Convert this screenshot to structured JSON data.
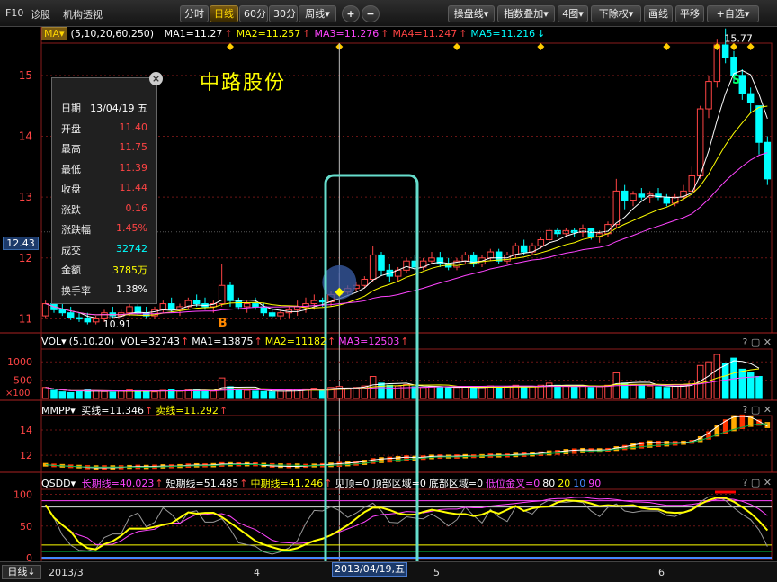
{
  "toolbar": {
    "left_tabs": [
      "F10",
      "诊股",
      "机构透视"
    ],
    "period_buttons": [
      "分时",
      "日线",
      "60分",
      "30分",
      "周线▾"
    ],
    "active_period": "日线",
    "zoom_in": "+",
    "zoom_out": "−",
    "right_buttons": [
      "操盘线▾",
      "指数叠加▾",
      "4图▾",
      "下除权▾",
      "画线",
      "平移",
      "+自选▾"
    ]
  },
  "stock_name": "中路股份",
  "ma_legend": {
    "selector": "MA▾",
    "params": "(5,10,20,60,250)",
    "items": [
      {
        "label": "MA1=11.27",
        "arrow": "↑",
        "color": "#ffffff"
      },
      {
        "label": "MA2=11.257",
        "arrow": "↑",
        "color": "#ffff00"
      },
      {
        "label": "MA3=11.276",
        "arrow": "↑",
        "color": "#ff44ff"
      },
      {
        "label": "MA4=11.247",
        "arrow": "↑",
        "color": "#ff4444"
      },
      {
        "label": "MA5=11.216",
        "arrow": "↓",
        "color": "#00ffff"
      }
    ]
  },
  "price_axis": {
    "ticks": [
      "15",
      "14",
      "13",
      "12",
      "11"
    ],
    "current_price_label": "12.43",
    "min": 10.8,
    "max": 15.5
  },
  "annotations": {
    "high_label": "15.77",
    "low_label": "10.91",
    "buy_marker": "B",
    "sell_marker": "S"
  },
  "info_panel": {
    "close_icon": "×",
    "rows": [
      {
        "k": "日期",
        "v": "13/04/19 五",
        "color": "#ffffff"
      },
      {
        "k": "开盘",
        "v": "11.40",
        "color": "#ff4444"
      },
      {
        "k": "最高",
        "v": "11.75",
        "color": "#ff4444"
      },
      {
        "k": "最低",
        "v": "11.39",
        "color": "#ff4444"
      },
      {
        "k": "收盘",
        "v": "11.44",
        "color": "#ff4444"
      },
      {
        "k": "涨跌",
        "v": "0.16",
        "color": "#ff4444"
      },
      {
        "k": "涨跌幅",
        "v": "+1.45%",
        "color": "#ff4444"
      },
      {
        "k": "成交",
        "v": "32742",
        "color": "#00ffff"
      },
      {
        "k": "金额",
        "v": "3785万",
        "color": "#ffff00"
      },
      {
        "k": "换手率",
        "v": "1.38%",
        "color": "#ffffff"
      }
    ]
  },
  "vol_panel": {
    "name": "VOL▾",
    "params": "(5,10,20)",
    "items": [
      {
        "label": "VOL=32743",
        "arrow": "↑",
        "color": "#ffffff"
      },
      {
        "label": "MA1=13875",
        "arrow": "↑",
        "color": "#ffffff"
      },
      {
        "label": "MA2=11182",
        "arrow": "↑",
        "color": "#ffff00"
      },
      {
        "label": "MA3=12503",
        "arrow": "↑",
        "color": "#ff44ff"
      }
    ],
    "ticks": [
      "1000",
      "500"
    ],
    "unit_label": "×100"
  },
  "mmpp_panel": {
    "name": "MMPP▾",
    "items": [
      {
        "label": "买线=11.346",
        "arrow": "↑",
        "color": "#ffffff"
      },
      {
        "label": "卖线=11.292",
        "arrow": "↑",
        "color": "#ffff00"
      }
    ],
    "ticks": [
      "14",
      "12"
    ]
  },
  "qsdd_panel": {
    "name": "QSDD▾",
    "items": [
      {
        "label": "长期线=40.023",
        "arrow": "↑",
        "color": "#ff44ff"
      },
      {
        "label": "短期线=51.485",
        "arrow": "↑",
        "color": "#ffffff"
      },
      {
        "label": "中期线=41.246",
        "arrow": "↑",
        "color": "#ffff00"
      },
      {
        "label": "见顶=0",
        "arrow": "",
        "color": "#ffffff"
      },
      {
        "label": "顶部区域=0",
        "arrow": "",
        "color": "#ffffff"
      },
      {
        "label": "底部区域=0",
        "arrow": "",
        "color": "#ffffff"
      },
      {
        "label": "低位金叉=0",
        "arrow": "",
        "color": "#ff44ff"
      },
      {
        "label": "80",
        "arrow": "",
        "color": "#ffffff"
      },
      {
        "label": "20",
        "arrow": "",
        "color": "#ffff00"
      },
      {
        "label": "10",
        "arrow": "",
        "color": "#4488ff"
      },
      {
        "label": "90",
        "arrow": "",
        "color": "#ff44ff"
      }
    ],
    "ticks": [
      "100",
      "50",
      "0"
    ]
  },
  "sub_controls": "? ▢ ✕",
  "bottom": {
    "period": "日线↓",
    "labels": [
      "2013/3",
      "4",
      "5",
      "6"
    ],
    "selected_date": "2013/04/19,五"
  },
  "colors": {
    "up": "#ff4444",
    "down": "#00ffff",
    "highlight_box": "#66ddcc"
  },
  "chart_data": {
    "type": "candlestick",
    "candles": [
      {
        "o": 11.05,
        "h": 11.3,
        "l": 11.0,
        "c": 11.25
      },
      {
        "o": 11.25,
        "h": 11.35,
        "l": 11.1,
        "c": 11.15
      },
      {
        "o": 11.15,
        "h": 11.25,
        "l": 11.05,
        "c": 11.1
      },
      {
        "o": 11.1,
        "h": 11.2,
        "l": 10.98,
        "c": 11.02
      },
      {
        "o": 11.02,
        "h": 11.1,
        "l": 10.95,
        "c": 11.0
      },
      {
        "o": 11.0,
        "h": 11.1,
        "l": 10.91,
        "c": 10.95
      },
      {
        "o": 10.95,
        "h": 11.05,
        "l": 10.91,
        "c": 11.0
      },
      {
        "o": 11.0,
        "h": 11.15,
        "l": 10.95,
        "c": 11.1
      },
      {
        "o": 11.1,
        "h": 11.2,
        "l": 11.0,
        "c": 11.05
      },
      {
        "o": 11.05,
        "h": 11.15,
        "l": 11.0,
        "c": 11.1
      },
      {
        "o": 11.1,
        "h": 11.25,
        "l": 11.05,
        "c": 11.2
      },
      {
        "o": 11.2,
        "h": 11.25,
        "l": 11.05,
        "c": 11.1
      },
      {
        "o": 11.1,
        "h": 11.2,
        "l": 11.0,
        "c": 11.05
      },
      {
        "o": 11.05,
        "h": 11.2,
        "l": 11.0,
        "c": 11.15
      },
      {
        "o": 11.15,
        "h": 11.3,
        "l": 11.1,
        "c": 11.25
      },
      {
        "o": 11.25,
        "h": 11.35,
        "l": 11.1,
        "c": 11.15
      },
      {
        "o": 11.15,
        "h": 11.25,
        "l": 11.05,
        "c": 11.2
      },
      {
        "o": 11.2,
        "h": 11.35,
        "l": 11.15,
        "c": 11.3
      },
      {
        "o": 11.3,
        "h": 11.4,
        "l": 11.2,
        "c": 11.25
      },
      {
        "o": 11.25,
        "h": 11.35,
        "l": 11.15,
        "c": 11.2
      },
      {
        "o": 11.2,
        "h": 11.3,
        "l": 11.1,
        "c": 11.25
      },
      {
        "o": 11.25,
        "h": 11.9,
        "l": 11.2,
        "c": 11.55
      },
      {
        "o": 11.55,
        "h": 11.6,
        "l": 11.2,
        "c": 11.3
      },
      {
        "o": 11.3,
        "h": 11.35,
        "l": 11.15,
        "c": 11.2
      },
      {
        "o": 11.2,
        "h": 11.3,
        "l": 11.1,
        "c": 11.25
      },
      {
        "o": 11.25,
        "h": 11.35,
        "l": 11.15,
        "c": 11.2
      },
      {
        "o": 11.2,
        "h": 11.25,
        "l": 11.05,
        "c": 11.1
      },
      {
        "o": 11.1,
        "h": 11.2,
        "l": 11.0,
        "c": 11.05
      },
      {
        "o": 11.05,
        "h": 11.15,
        "l": 10.98,
        "c": 11.1
      },
      {
        "o": 11.1,
        "h": 11.2,
        "l": 11.0,
        "c": 11.15
      },
      {
        "o": 11.15,
        "h": 11.3,
        "l": 11.05,
        "c": 11.2
      },
      {
        "o": 11.2,
        "h": 11.35,
        "l": 11.1,
        "c": 11.25
      },
      {
        "o": 11.25,
        "h": 11.4,
        "l": 11.15,
        "c": 11.3
      },
      {
        "o": 11.3,
        "h": 11.35,
        "l": 11.2,
        "c": 11.28
      },
      {
        "o": 11.28,
        "h": 11.45,
        "l": 11.2,
        "c": 11.4
      },
      {
        "o": 11.4,
        "h": 11.75,
        "l": 11.39,
        "c": 11.44
      },
      {
        "o": 11.44,
        "h": 11.55,
        "l": 11.4,
        "c": 11.5
      },
      {
        "o": 11.5,
        "h": 11.6,
        "l": 11.45,
        "c": 11.55
      },
      {
        "o": 11.55,
        "h": 11.7,
        "l": 11.5,
        "c": 11.65
      },
      {
        "o": 11.65,
        "h": 12.2,
        "l": 11.6,
        "c": 12.05
      },
      {
        "o": 12.05,
        "h": 12.1,
        "l": 11.7,
        "c": 11.8
      },
      {
        "o": 11.8,
        "h": 11.9,
        "l": 11.6,
        "c": 11.7
      },
      {
        "o": 11.7,
        "h": 11.85,
        "l": 11.6,
        "c": 11.8
      },
      {
        "o": 11.8,
        "h": 12.0,
        "l": 11.75,
        "c": 11.95
      },
      {
        "o": 11.95,
        "h": 12.05,
        "l": 11.8,
        "c": 11.85
      },
      {
        "o": 11.85,
        "h": 12.0,
        "l": 11.8,
        "c": 11.95
      },
      {
        "o": 11.95,
        "h": 12.1,
        "l": 11.9,
        "c": 12.0
      },
      {
        "o": 12.0,
        "h": 12.1,
        "l": 11.85,
        "c": 11.9
      },
      {
        "o": 11.9,
        "h": 12.0,
        "l": 11.8,
        "c": 11.85
      },
      {
        "o": 11.85,
        "h": 12.0,
        "l": 11.8,
        "c": 11.95
      },
      {
        "o": 11.95,
        "h": 12.1,
        "l": 11.9,
        "c": 12.05
      },
      {
        "o": 12.05,
        "h": 12.1,
        "l": 11.85,
        "c": 11.9
      },
      {
        "o": 11.9,
        "h": 12.05,
        "l": 11.85,
        "c": 12.0
      },
      {
        "o": 12.0,
        "h": 12.15,
        "l": 11.95,
        "c": 12.1
      },
      {
        "o": 12.1,
        "h": 12.15,
        "l": 11.9,
        "c": 11.95
      },
      {
        "o": 11.95,
        "h": 12.1,
        "l": 11.9,
        "c": 12.05
      },
      {
        "o": 12.05,
        "h": 12.25,
        "l": 12.0,
        "c": 12.2
      },
      {
        "o": 12.2,
        "h": 12.3,
        "l": 12.05,
        "c": 12.1
      },
      {
        "o": 12.1,
        "h": 12.25,
        "l": 12.05,
        "c": 12.2
      },
      {
        "o": 12.2,
        "h": 12.35,
        "l": 12.15,
        "c": 12.3
      },
      {
        "o": 12.3,
        "h": 12.5,
        "l": 12.25,
        "c": 12.45
      },
      {
        "o": 12.45,
        "h": 12.5,
        "l": 12.35,
        "c": 12.4
      },
      {
        "o": 12.4,
        "h": 12.5,
        "l": 12.35,
        "c": 12.45
      },
      {
        "o": 12.45,
        "h": 12.5,
        "l": 12.35,
        "c": 12.42
      },
      {
        "o": 12.42,
        "h": 12.55,
        "l": 12.35,
        "c": 12.48
      },
      {
        "o": 12.48,
        "h": 12.5,
        "l": 12.3,
        "c": 12.35
      },
      {
        "o": 12.35,
        "h": 12.45,
        "l": 12.25,
        "c": 12.4
      },
      {
        "o": 12.4,
        "h": 12.6,
        "l": 12.35,
        "c": 12.55
      },
      {
        "o": 12.55,
        "h": 13.3,
        "l": 12.5,
        "c": 13.1
      },
      {
        "o": 13.1,
        "h": 13.2,
        "l": 12.8,
        "c": 12.95
      },
      {
        "o": 12.95,
        "h": 13.1,
        "l": 12.85,
        "c": 13.05
      },
      {
        "o": 13.05,
        "h": 13.15,
        "l": 12.95,
        "c": 13.0
      },
      {
        "o": 13.0,
        "h": 13.1,
        "l": 12.9,
        "c": 13.05
      },
      {
        "o": 13.05,
        "h": 13.15,
        "l": 12.95,
        "c": 13.0
      },
      {
        "o": 13.0,
        "h": 13.05,
        "l": 12.85,
        "c": 12.9
      },
      {
        "o": 12.9,
        "h": 13.05,
        "l": 12.85,
        "c": 13.0
      },
      {
        "o": 13.0,
        "h": 13.2,
        "l": 12.95,
        "c": 13.1
      },
      {
        "o": 13.1,
        "h": 13.5,
        "l": 13.05,
        "c": 13.35
      },
      {
        "o": 13.35,
        "h": 14.5,
        "l": 13.3,
        "c": 14.45
      },
      {
        "o": 14.45,
        "h": 15.0,
        "l": 14.3,
        "c": 14.9
      },
      {
        "o": 14.9,
        "h": 15.6,
        "l": 14.8,
        "c": 15.5
      },
      {
        "o": 15.5,
        "h": 15.77,
        "l": 15.2,
        "c": 15.3
      },
      {
        "o": 15.3,
        "h": 15.4,
        "l": 14.9,
        "c": 15.0
      },
      {
        "o": 15.0,
        "h": 15.1,
        "l": 14.6,
        "c": 14.7
      },
      {
        "o": 14.7,
        "h": 14.8,
        "l": 14.4,
        "c": 14.55
      },
      {
        "o": 14.5,
        "h": 14.5,
        "l": 13.7,
        "c": 13.9
      },
      {
        "o": 13.9,
        "h": 14.0,
        "l": 13.2,
        "c": 13.3
      }
    ],
    "volume": [
      300,
      220,
      180,
      160,
      200,
      240,
      210,
      190,
      170,
      200,
      230,
      210,
      190,
      180,
      220,
      240,
      200,
      230,
      250,
      210,
      200,
      560,
      320,
      240,
      220,
      200,
      190,
      180,
      200,
      220,
      240,
      260,
      280,
      240,
      300,
      327,
      280,
      300,
      340,
      600,
      420,
      360,
      340,
      380,
      320,
      300,
      330,
      310,
      290,
      300,
      320,
      280,
      300,
      340,
      300,
      320,
      360,
      300,
      320,
      360,
      420,
      360,
      340,
      330,
      350,
      300,
      320,
      360,
      700,
      420,
      380,
      360,
      340,
      320,
      300,
      330,
      360,
      480,
      900,
      1000,
      1200,
      950,
      1100,
      800,
      700,
      600
    ],
    "ma_values": {
      "MA1": 11.27,
      "MA2": 11.257,
      "MA3": 11.276,
      "MA4": 11.247,
      "MA5": 11.216
    }
  }
}
